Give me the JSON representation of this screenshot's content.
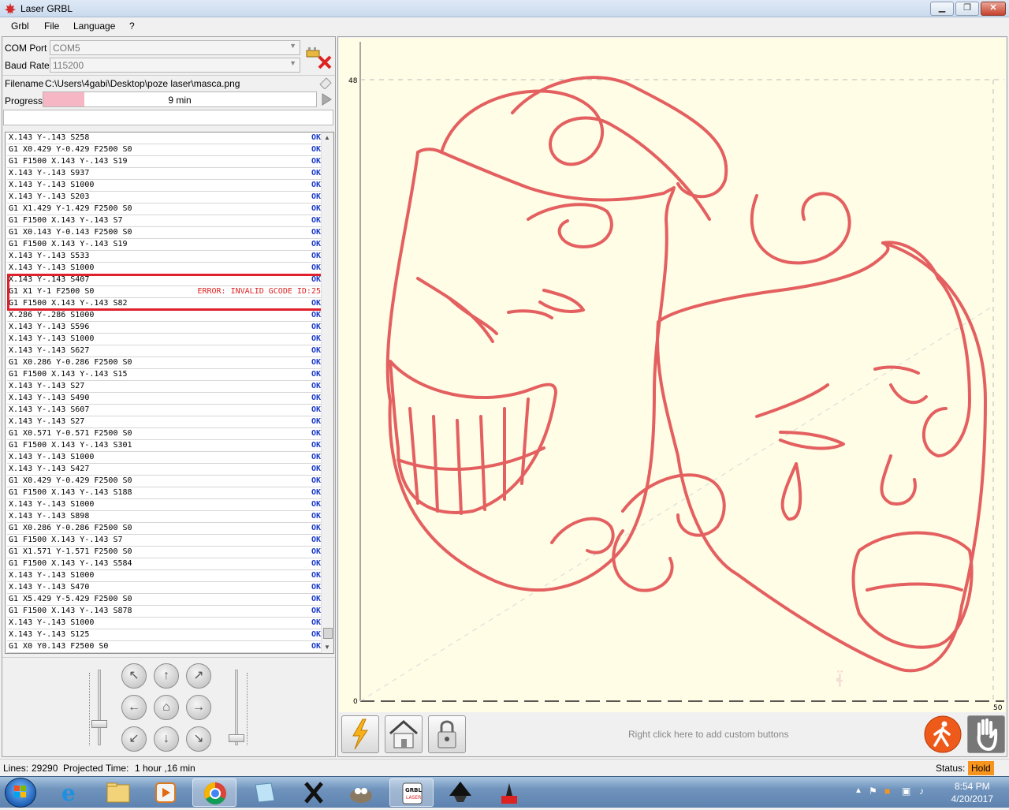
{
  "window": {
    "title": "Laser GRBL",
    "minimize": "▁",
    "restore": "❐",
    "close": "✕"
  },
  "menu": [
    "Grbl",
    "File",
    "Language",
    "?"
  ],
  "connection": {
    "com_label": "COM Port",
    "com_value": "COM5",
    "baud_label": "Baud Rate",
    "baud_value": "115200"
  },
  "file": {
    "filename_label": "Filename",
    "filename_value": "C:\\Users\\4gabi\\Desktop\\poze laser\\masca.png",
    "progress_label": "Progress",
    "progress_text": "9 min",
    "progress_fraction": 0.15
  },
  "log": [
    {
      "cmd": "X.143 Y-.143 S258",
      "status": "OK"
    },
    {
      "cmd": "G1 X0.429 Y-0.429 F2500 S0",
      "status": "OK"
    },
    {
      "cmd": "G1 F1500 X.143 Y-.143 S19",
      "status": "OK"
    },
    {
      "cmd": "X.143 Y-.143 S937",
      "status": "OK"
    },
    {
      "cmd": "X.143 Y-.143 S1000",
      "status": "OK"
    },
    {
      "cmd": "X.143 Y-.143 S203",
      "status": "OK"
    },
    {
      "cmd": "G1 X1.429 Y-1.429 F2500 S0",
      "status": "OK"
    },
    {
      "cmd": "G1 F1500 X.143 Y-.143 S7",
      "status": "OK"
    },
    {
      "cmd": "G1 X0.143 Y-0.143 F2500 S0",
      "status": "OK"
    },
    {
      "cmd": "G1 F1500 X.143 Y-.143 S19",
      "status": "OK"
    },
    {
      "cmd": "X.143 Y-.143 S533",
      "status": "OK"
    },
    {
      "cmd": "X.143 Y-.143 S1000",
      "status": "OK"
    },
    {
      "cmd": "X.143 Y-.143 S407",
      "status": "OK"
    },
    {
      "cmd": "G1 X1 Y-1 F2500 S0",
      "status": "ERROR: INVALID GCODE ID:25",
      "error": true
    },
    {
      "cmd": "G1 F1500 X.143 Y-.143 S82",
      "status": "OK"
    },
    {
      "cmd": "X.286 Y-.286 S1000",
      "status": "OK"
    },
    {
      "cmd": "X.143 Y-.143 S596",
      "status": "OK"
    },
    {
      "cmd": "X.143 Y-.143 S1000",
      "status": "OK"
    },
    {
      "cmd": "X.143 Y-.143 S627",
      "status": "OK"
    },
    {
      "cmd": "G1 X0.286 Y-0.286 F2500 S0",
      "status": "OK"
    },
    {
      "cmd": "G1 F1500 X.143 Y-.143 S15",
      "status": "OK"
    },
    {
      "cmd": "X.143 Y-.143 S27",
      "status": "OK"
    },
    {
      "cmd": "X.143 Y-.143 S490",
      "status": "OK"
    },
    {
      "cmd": "X.143 Y-.143 S607",
      "status": "OK"
    },
    {
      "cmd": "X.143 Y-.143 S27",
      "status": "OK"
    },
    {
      "cmd": "G1 X0.571 Y-0.571 F2500 S0",
      "status": "OK"
    },
    {
      "cmd": "G1 F1500 X.143 Y-.143 S301",
      "status": "OK"
    },
    {
      "cmd": "X.143 Y-.143 S1000",
      "status": "OK"
    },
    {
      "cmd": "X.143 Y-.143 S427",
      "status": "OK"
    },
    {
      "cmd": "G1 X0.429 Y-0.429 F2500 S0",
      "status": "OK"
    },
    {
      "cmd": "G1 F1500 X.143 Y-.143 S188",
      "status": "OK"
    },
    {
      "cmd": "X.143 Y-.143 S1000",
      "status": "OK"
    },
    {
      "cmd": "X.143 Y-.143 S898",
      "status": "OK"
    },
    {
      "cmd": "G1 X0.286 Y-0.286 F2500 S0",
      "status": "OK"
    },
    {
      "cmd": "G1 F1500 X.143 Y-.143 S7",
      "status": "OK"
    },
    {
      "cmd": "G1 X1.571 Y-1.571 F2500 S0",
      "status": "OK"
    },
    {
      "cmd": "G1 F1500 X.143 Y-.143 S584",
      "status": "OK"
    },
    {
      "cmd": "X.143 Y-.143 S1000",
      "status": "OK"
    },
    {
      "cmd": "X.143 Y-.143 S470",
      "status": "OK"
    },
    {
      "cmd": "G1 X5.429 Y-5.429 F2500 S0",
      "status": "OK"
    },
    {
      "cmd": "G1 F1500 X.143 Y-.143 S878",
      "status": "OK"
    },
    {
      "cmd": "X.143 Y-.143 S1000",
      "status": "OK"
    },
    {
      "cmd": "X.143 Y-.143 S125",
      "status": "OK"
    },
    {
      "cmd": "G1 X0 Y0.143 F2500 S0",
      "status": "OK"
    }
  ],
  "jog": {
    "buttons": [
      {
        "name": "jog-up-left-button",
        "glyph": "↖"
      },
      {
        "name": "jog-up-button",
        "glyph": "↑"
      },
      {
        "name": "jog-up-right-button",
        "glyph": "↗"
      },
      {
        "name": "jog-left-button",
        "glyph": "←"
      },
      {
        "name": "jog-home-button",
        "glyph": "⌂"
      },
      {
        "name": "jog-right-button",
        "glyph": "→"
      },
      {
        "name": "jog-down-left-button",
        "glyph": "↙"
      },
      {
        "name": "jog-down-button",
        "glyph": "↓"
      },
      {
        "name": "jog-down-right-button",
        "glyph": "↘"
      }
    ]
  },
  "canvas": {
    "y_max_label": "48",
    "origin_label": "0",
    "x_max_label": "50",
    "stroke_color": "#e46060",
    "background": "#fffde6"
  },
  "actions": {
    "icons": [
      "lightning-icon",
      "home-icon",
      "lock-icon",
      "walk-icon",
      "stop-hand-icon"
    ],
    "custom_hint": "Right click here to add custom buttons"
  },
  "status": {
    "lines_label": "Lines:",
    "lines_value": "29290",
    "projected_label": "Projected Time:",
    "projected_value": "1 hour ,16 min",
    "status_label": "Status:",
    "status_value": "Hold",
    "status_color": "#f7941d"
  },
  "taskbar": {
    "apps": [
      "ie-icon",
      "explorer-icon",
      "media-player-icon",
      "chrome-icon",
      "notepad-icon",
      "x-app-icon",
      "gimp-icon",
      "grbl-laser-icon",
      "inkscape-icon",
      "laser-app-icon"
    ],
    "time": "8:54 PM",
    "date": "4/20/2017"
  }
}
